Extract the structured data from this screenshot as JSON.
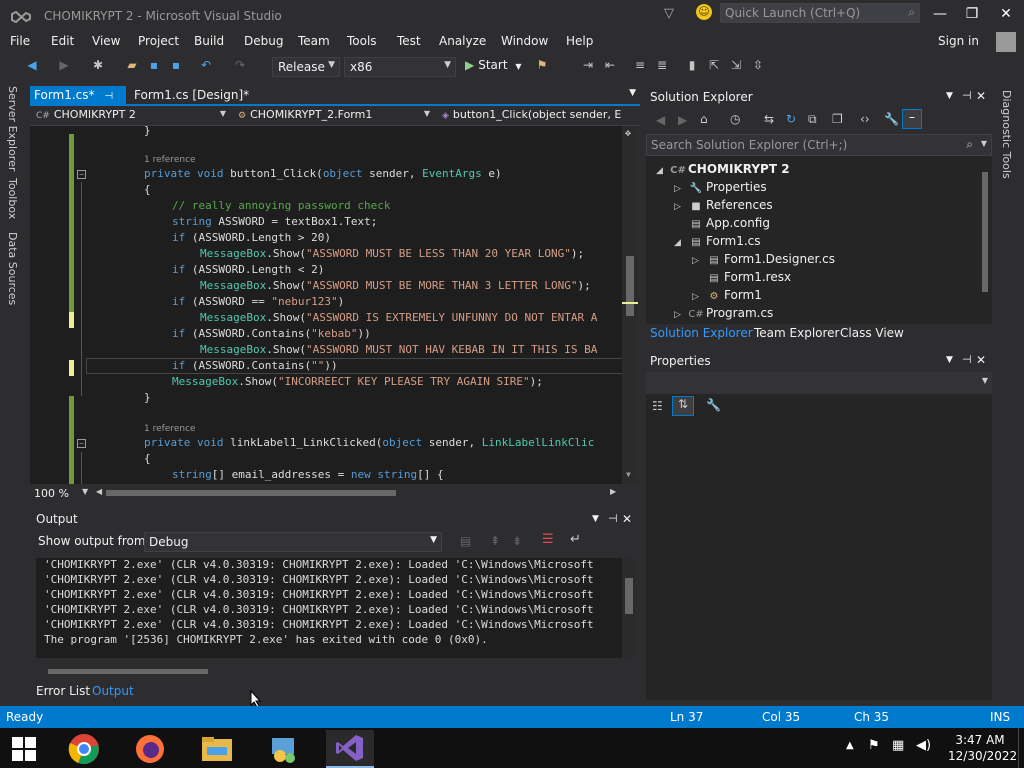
{
  "window": {
    "title": "CHOMIKRYPT 2 - Microsoft Visual Studio",
    "quick_launch_placeholder": "Quick Launch (Ctrl+Q)"
  },
  "menu": [
    "File",
    "Edit",
    "View",
    "Project",
    "Build",
    "Debug",
    "Team",
    "Tools",
    "Test",
    "Analyze",
    "Window",
    "Help"
  ],
  "sign_in": "Sign in",
  "toolbar": {
    "configuration": "Release",
    "platform": "x86",
    "start_label": "Start"
  },
  "left_tabs": [
    "Server Explorer",
    "Toolbox",
    "Data Sources"
  ],
  "editor_tabs": [
    {
      "label": "Form1.cs*"
    },
    {
      "label": "Form1.cs [Design]*"
    }
  ],
  "nav": {
    "project": "CHOMIKRYPT 2",
    "class": "CHOMIKRYPT_2.Form1",
    "member": "button1_Click(object sender, E"
  },
  "code": {
    "brace_close_top": "}",
    "ref1": "1 reference",
    "ref2": "1 reference",
    "l_sig1_a": "private void ",
    "l_sig1_b": "button1_Click(",
    "l_sig1_c": "object",
    "l_sig1_d": " sender, ",
    "l_sig1_e": "EventArgs",
    "l_sig1_f": " e)",
    "open1": "{",
    "comment": "// really annoying password check",
    "l2_a": "string",
    "l2_b": " ASSWORD = textBox1.Text;",
    "l3_a": "if",
    "l3_b": " (ASSWORD.Length > 20)",
    "l4_a": "MessageBox",
    "l4_b": ".Show(",
    "l4_c": "\"ASSWORD MUST BE LESS THAN 20 YEAR LONG\"",
    "l4_d": ");",
    "l5_a": "if",
    "l5_b": " (ASSWORD.Length < 2)",
    "l6_a": "MessageBox",
    "l6_b": ".Show(",
    "l6_c": "\"ASSWORD MUST BE MORE THAN 3 LETTER LONG\"",
    "l6_d": ");",
    "l7_a": "if",
    "l7_b": " (ASSWORD == ",
    "l7_c": "\"nebur123\"",
    "l7_d": ")",
    "l8_a": "MessageBox",
    "l8_b": ".Show(",
    "l8_c": "\"ASSWORD IS EXTREMELY UNFUNNY DO NOT ENTAR A",
    "l9_a": "if",
    "l9_b": " (ASSWORD.Contains(",
    "l9_c": "\"kebab\"",
    "l9_d": "))",
    "l10_a": "MessageBox",
    "l10_b": ".Show(",
    "l10_c": "\"ASSWORD MUST NOT HAV KEBAB IN IT THIS IS BA",
    "l11_a": "if",
    "l11_b": " (ASSWORD.Contains(",
    "l11_c": "\"\"",
    "l11_d": "))",
    "l12_a": "MessageBox",
    "l12_b": ".Show(",
    "l12_c": "\"INCORREECT KEY PLEASE TRY AGAIN SIRE\"",
    "l12_d": ");",
    "close1": "}",
    "l_sig2_a": "private void ",
    "l_sig2_b": "linkLabel1_LinkClicked(",
    "l_sig2_c": "object",
    "l_sig2_d": " sender, ",
    "l_sig2_e": "LinkLabelLinkClic",
    "open2": "{",
    "l13_a": "string",
    "l13_b": "[] email_addresses = ",
    "l13_c": "new",
    "l13_d": " ",
    "l13_e": "string",
    "l13_f": "[] {"
  },
  "zoom": "100 %",
  "output": {
    "title": "Output",
    "show_from_label": "Show output from:",
    "source": "Debug",
    "lines": [
      "'CHOMIKRYPT 2.exe' (CLR v4.0.30319: CHOMIKRYPT 2.exe): Loaded 'C:\\Windows\\Microsoft",
      "'CHOMIKRYPT 2.exe' (CLR v4.0.30319: CHOMIKRYPT 2.exe): Loaded 'C:\\Windows\\Microsoft",
      "'CHOMIKRYPT 2.exe' (CLR v4.0.30319: CHOMIKRYPT 2.exe): Loaded 'C:\\Windows\\Microsoft",
      "'CHOMIKRYPT 2.exe' (CLR v4.0.30319: CHOMIKRYPT 2.exe): Loaded 'C:\\Windows\\Microsoft",
      "'CHOMIKRYPT 2.exe' (CLR v4.0.30319: CHOMIKRYPT 2.exe): Loaded 'C:\\Windows\\Microsoft",
      "The program '[2536] CHOMIKRYPT 2.exe' has exited with code 0 (0x0)."
    ]
  },
  "bottom_tabs": [
    "Error List",
    "Output"
  ],
  "solution_explorer": {
    "title": "Solution Explorer",
    "search_placeholder": "Search Solution Explorer (Ctrl+;)",
    "tree": [
      {
        "label": "CHOMIKRYPT 2",
        "icon": "C#",
        "exp": "◢"
      },
      {
        "label": "Properties",
        "icon": "🔧",
        "exp": "▷"
      },
      {
        "label": "References",
        "icon": "■",
        "exp": "▷"
      },
      {
        "label": "App.config",
        "icon": "▤",
        "exp": ""
      },
      {
        "label": "Form1.cs",
        "icon": "▤",
        "exp": "◢"
      },
      {
        "label": "Form1.Designer.cs",
        "icon": "▤",
        "exp": "▷"
      },
      {
        "label": "Form1.resx",
        "icon": "▤",
        "exp": ""
      },
      {
        "label": "Form1",
        "icon": "⚙",
        "exp": "▷"
      },
      {
        "label": "Program.cs",
        "icon": "C#",
        "exp": "▷"
      }
    ],
    "tabs": [
      "Solution Explorer",
      "Team Explorer",
      "Class View"
    ]
  },
  "properties": {
    "title": "Properties"
  },
  "diagnostic_tools": "Diagnostic Tools",
  "status": {
    "ready": "Ready",
    "ln": "Ln 37",
    "col": "Col 35",
    "ch": "Ch 35",
    "mode": "INS"
  },
  "clock": {
    "time": "3:47 AM",
    "date": "12/30/2022"
  },
  "colors": {
    "accent": "#007acc",
    "background": "#2d2d30",
    "editor_bg": "#1e1e1e"
  }
}
